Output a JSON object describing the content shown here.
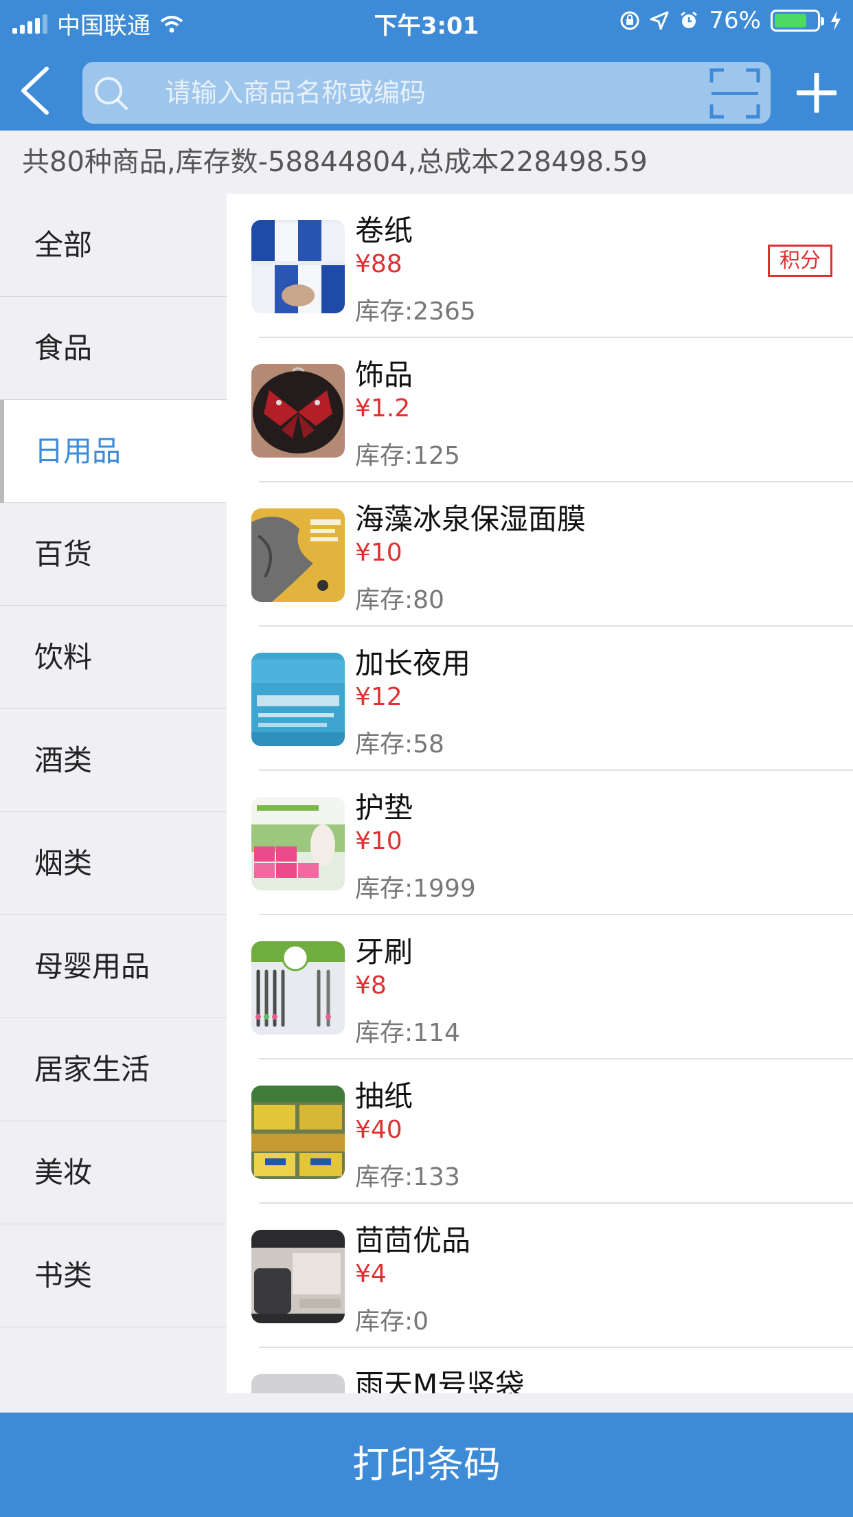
{
  "status_bar": {
    "carrier": "中国联通",
    "time": "下午3:01",
    "battery": "76%"
  },
  "header": {
    "search_placeholder": "请输入商品名称或编码"
  },
  "summary": "共80种商品,库存数-58844804,总成本228498.59",
  "categories": [
    {
      "label": "全部"
    },
    {
      "label": "食品"
    },
    {
      "label": "日用品"
    },
    {
      "label": "百货"
    },
    {
      "label": "饮料"
    },
    {
      "label": "酒类"
    },
    {
      "label": "烟类"
    },
    {
      "label": "母婴用品"
    },
    {
      "label": "居家生活"
    },
    {
      "label": "美妆"
    },
    {
      "label": "书类"
    }
  ],
  "active_category": "日用品",
  "products": [
    {
      "name": "卷纸",
      "price": "¥88",
      "stock": "库存:2365",
      "badge": "积分"
    },
    {
      "name": "饰品",
      "price": "¥1.2",
      "stock": "库存:125"
    },
    {
      "name": "海藻冰泉保湿面膜",
      "price": "¥10",
      "stock": "库存:80"
    },
    {
      "name": "加长夜用",
      "price": "¥12",
      "stock": "库存:58"
    },
    {
      "name": "护垫",
      "price": "¥10",
      "stock": "库存:1999"
    },
    {
      "name": "牙刷",
      "price": "¥8",
      "stock": "库存:114"
    },
    {
      "name": "抽纸",
      "price": "¥40",
      "stock": "库存:133"
    },
    {
      "name": "茴茴优品",
      "price": "¥4",
      "stock": "库存:0"
    },
    {
      "name": "雨天M号竖袋",
      "price": "",
      "stock": ""
    }
  ],
  "footer": {
    "print_label": "打印条码"
  },
  "colors": {
    "primary": "#3d8bd6",
    "price": "#e03030",
    "battery": "#4cd964"
  }
}
